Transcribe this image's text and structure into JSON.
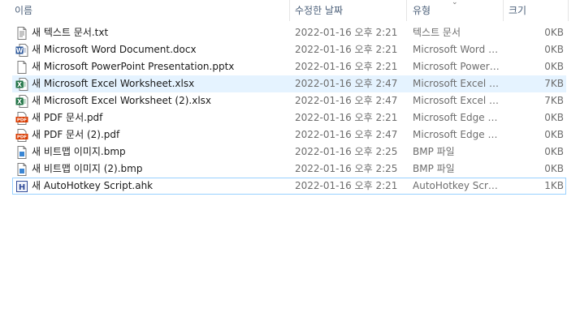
{
  "columns": {
    "name": "이름",
    "date": "수정한 날짜",
    "type": "유형",
    "size": "크기"
  },
  "files": [
    {
      "name": "새 텍스트 문서.txt",
      "date": "2022-01-16 오후 2:21",
      "type": "텍스트 문서",
      "size": "0KB",
      "icon": "text-document-icon"
    },
    {
      "name": "새 Microsoft Word Document.docx",
      "date": "2022-01-16 오후 2:21",
      "type": "Microsoft Word D...",
      "size": "0KB",
      "icon": "word-document-icon"
    },
    {
      "name": "새 Microsoft PowerPoint Presentation.pptx",
      "date": "2022-01-16 오후 2:21",
      "type": "Microsoft PowerP...",
      "size": "0KB",
      "icon": "powerpoint-document-icon"
    },
    {
      "name": "새 Microsoft Excel Worksheet.xlsx",
      "date": "2022-01-16 오후 2:47",
      "type": "Microsoft Excel W...",
      "size": "7KB",
      "icon": "excel-document-icon"
    },
    {
      "name": "새 Microsoft Excel Worksheet (2).xlsx",
      "date": "2022-01-16 오후 2:47",
      "type": "Microsoft Excel W...",
      "size": "7KB",
      "icon": "excel-document-icon"
    },
    {
      "name": "새 PDF 문서.pdf",
      "date": "2022-01-16 오후 2:21",
      "type": "Microsoft Edge P...",
      "size": "0KB",
      "icon": "pdf-document-icon"
    },
    {
      "name": "새 PDF 문서 (2).pdf",
      "date": "2022-01-16 오후 2:47",
      "type": "Microsoft Edge P...",
      "size": "0KB",
      "icon": "pdf-document-icon"
    },
    {
      "name": "새 비트맵 이미지.bmp",
      "date": "2022-01-16 오후 2:25",
      "type": "BMP 파일",
      "size": "0KB",
      "icon": "bitmap-image-icon"
    },
    {
      "name": "새 비트맵 이미지 (2).bmp",
      "date": "2022-01-16 오후 2:25",
      "type": "BMP 파일",
      "size": "0KB",
      "icon": "bitmap-image-icon"
    },
    {
      "name": "새 AutoHotkey Script.ahk",
      "date": "2022-01-16 오후 2:21",
      "type": "AutoHotkey Script",
      "size": "1KB",
      "icon": "autohotkey-script-icon"
    }
  ],
  "selected_index": 3,
  "focused_index": 9,
  "colors": {
    "word": "#2b579a",
    "excel": "#217346",
    "pdf": "#d83b01",
    "ahk": "#334c99"
  }
}
